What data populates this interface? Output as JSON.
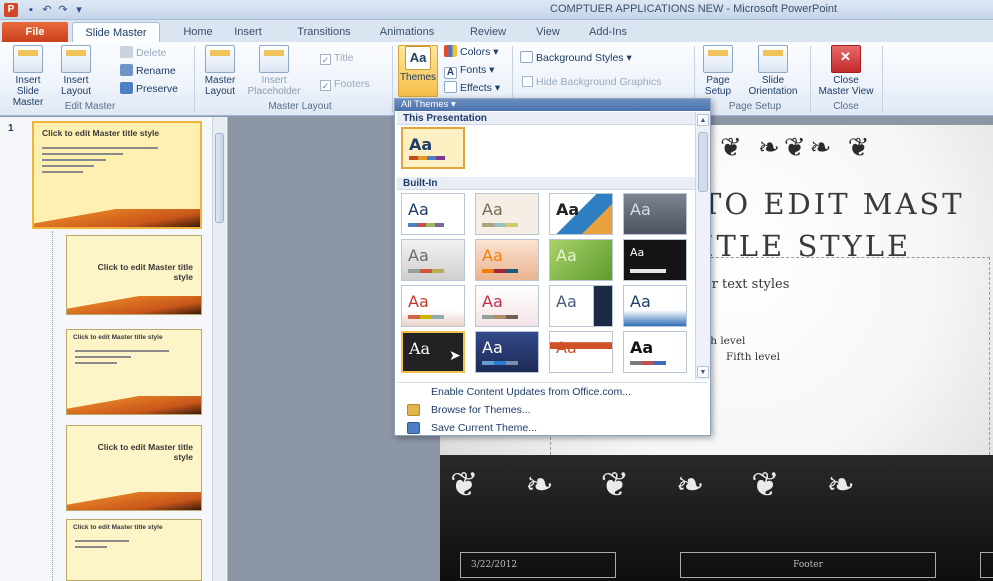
{
  "window": {
    "app_icon": "P",
    "title": "COMPTUER APPLICATIONS NEW  -  Microsoft PowerPoint"
  },
  "tabs": {
    "file": "File",
    "slide_master": "Slide Master",
    "home": "Home",
    "insert": "Insert",
    "transitions": "Transitions",
    "animations": "Animations",
    "review": "Review",
    "view": "View",
    "addins": "Add-Ins"
  },
  "ribbon": {
    "edit_master": {
      "label": "Edit Master",
      "insert_slide_master": "Insert Slide\nMaster",
      "insert_layout": "Insert\nLayout",
      "delete": "Delete",
      "rename": "Rename",
      "preserve": "Preserve"
    },
    "master_layout": {
      "label": "Master Layout",
      "master_layout_btn": "Master\nLayout",
      "insert_placeholder": "Insert\nPlaceholder",
      "title": "Title",
      "footers": "Footers"
    },
    "edit_theme": {
      "themes": "Themes",
      "colors": "Colors",
      "fonts": "Fonts",
      "effects": "Effects"
    },
    "background": {
      "background_styles": "Background Styles",
      "hide_background_graphics": "Hide Background Graphics"
    },
    "page_setup": {
      "label": "Page Setup",
      "page_setup_btn": "Page\nSetup",
      "slide_orientation": "Slide\nOrientation"
    },
    "close": {
      "label": "Close",
      "close_master_view": "Close\nMaster View"
    }
  },
  "gallery": {
    "header": "All Themes",
    "this_presentation": "This Presentation",
    "built_in": "Built-In",
    "tile_glyph": "Aa",
    "menu": {
      "enable_updates": "Enable Content Updates from Office.com...",
      "browse": "Browse for Themes...",
      "save": "Save Current Theme..."
    }
  },
  "thumbnails": {
    "slide_number": "1",
    "master_title": "Click to edit Master title style",
    "layout_title_right": "Click to edit Master title style",
    "layout_title_left": "Click to edit Master title style"
  },
  "slide": {
    "title_line1": "TO EDIT MAST",
    "title_line2": "ITLE STYLE",
    "body_line1": "er text styles",
    "body_line4": "th level",
    "body_line5": "Fifth level",
    "footer_date": "3/22/2012",
    "footer_text": "Footer"
  },
  "colors": {
    "ribbon_bg": "#eef3fa",
    "file_tab": "#d24726",
    "gallery_header": "#4a71ad",
    "selected_theme": "#e1a53c",
    "thumbnail_bg": "#fdf5c8"
  }
}
